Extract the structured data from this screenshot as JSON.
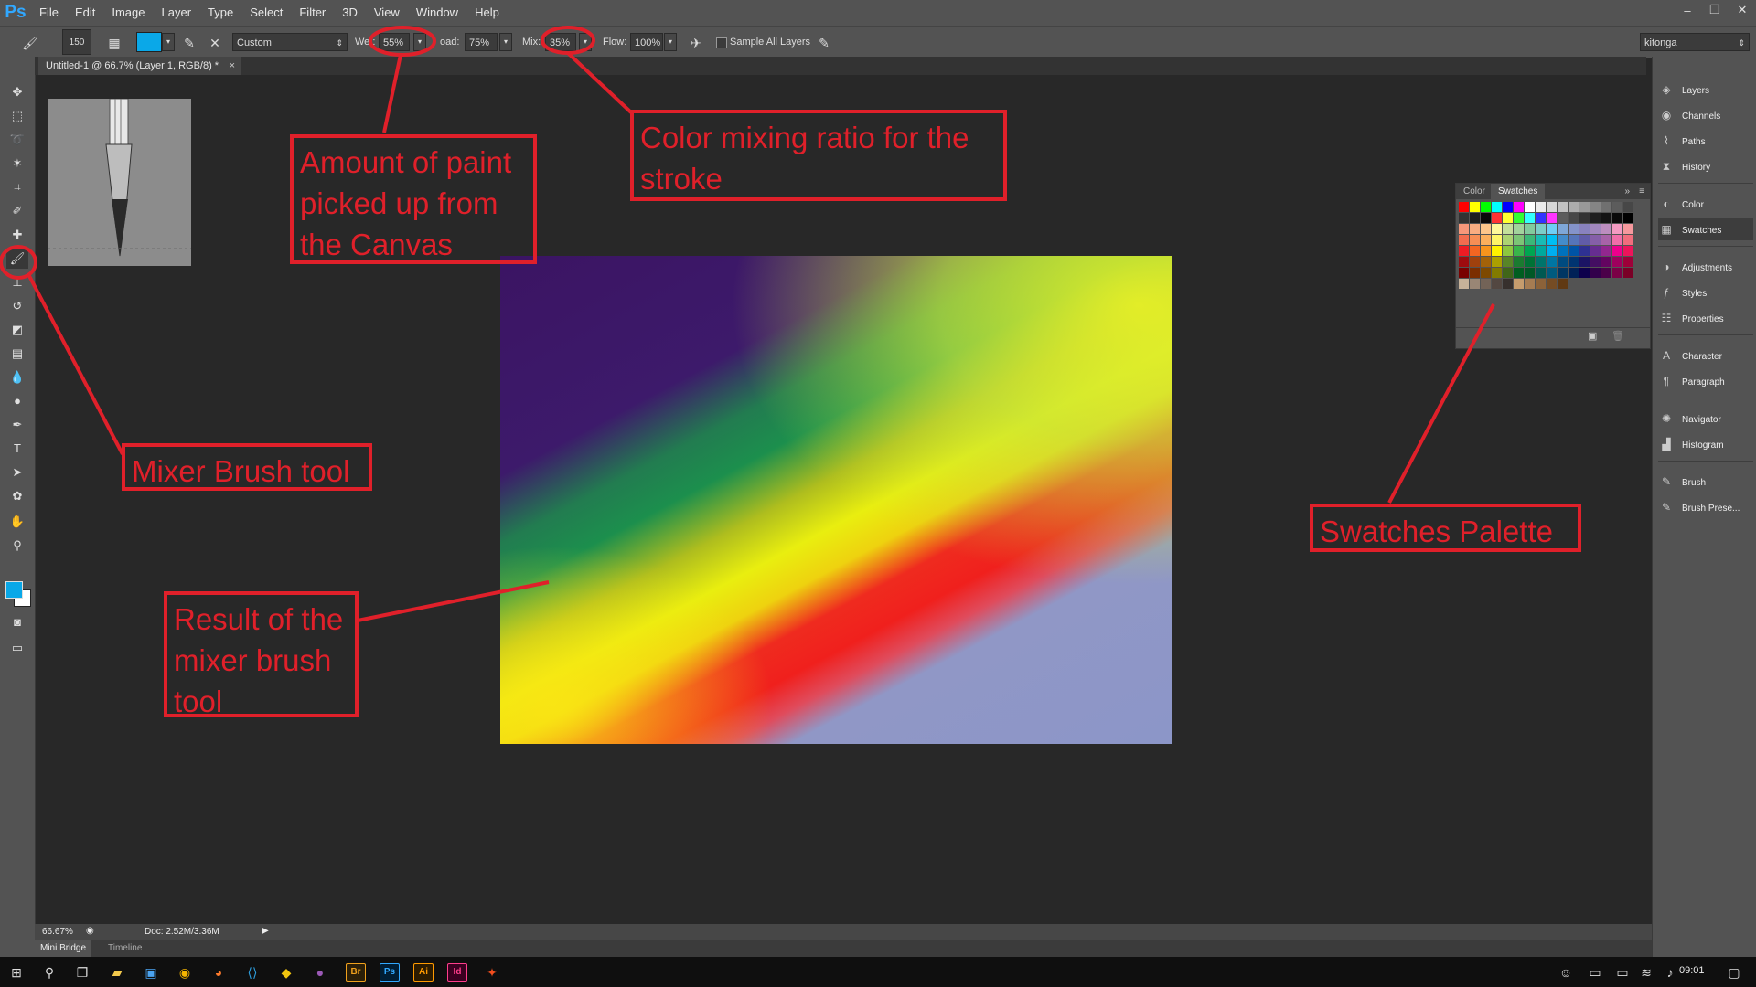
{
  "app": {
    "logo": "Ps"
  },
  "menu": [
    "File",
    "Edit",
    "Image",
    "Layer",
    "Type",
    "Select",
    "Filter",
    "3D",
    "View",
    "Window",
    "Help"
  ],
  "window_controls": {
    "minimize": "‒",
    "restore": "❐",
    "close": "✕"
  },
  "options": {
    "brush_size": "150",
    "preset": "Custom",
    "wet_label": "Wet:",
    "wet_value": "55%",
    "load_label": "oad:",
    "load_value": "75%",
    "mix_label": "Mix:",
    "mix_value": "35%",
    "flow_label": "Flow:",
    "flow_value": "100%",
    "sample_all_layers": "Sample All Layers",
    "workspace": "kitonga",
    "foreground_color": "#0aa8e8"
  },
  "document_tab": {
    "title": "Untitled-1 @ 66.7% (Layer 1, RGB/8) *",
    "close": "×"
  },
  "dock": {
    "items": [
      "Layers",
      "Channels",
      "Paths",
      "History",
      "Color",
      "Swatches",
      "Adjustments",
      "Styles",
      "Properties",
      "Character",
      "Paragraph",
      "Navigator",
      "Histogram",
      "Brush",
      "Brush Prese..."
    ],
    "active": "Swatches"
  },
  "swatches_panel": {
    "tabs": [
      "Color",
      "Swatches"
    ],
    "active_tab": "Swatches",
    "rows": [
      [
        "#ff0000",
        "#ffff00",
        "#00ff00",
        "#00ffff",
        "#0000ff",
        "#ff00ff",
        "#ffffff",
        "#ebebeb",
        "#d6d6d6",
        "#c2c2c2",
        "#adadad",
        "#999999",
        "#858585",
        "#707070",
        "#5c5c5c",
        "#474747"
      ],
      [
        "#333333",
        "#1f1f1f",
        "#0a0a0a",
        "#ff3333",
        "#ffff33",
        "#33ff33",
        "#33ffff",
        "#3333ff",
        "#ff33ff",
        "#5c5c5c",
        "#474747",
        "#333333",
        "#1f1f1f",
        "#141414",
        "#0a0a0a",
        "#000000"
      ],
      [
        "#f7977a",
        "#f9ad81",
        "#fdc68a",
        "#fff79a",
        "#c4df9b",
        "#a2d39c",
        "#82ca9d",
        "#7bcdc8",
        "#6ecff6",
        "#7ea7d8",
        "#8493ca",
        "#8882be",
        "#a187be",
        "#bc8dbf",
        "#f49ac2",
        "#f6989d"
      ],
      [
        "#f26c4f",
        "#f68e55",
        "#fbaf5c",
        "#fff467",
        "#acd372",
        "#7cc576",
        "#3bb878",
        "#1abbb4",
        "#00bff3",
        "#438ccb",
        "#5574b9",
        "#605ca8",
        "#855fa8",
        "#a763a8",
        "#f06ea9",
        "#f26d7d"
      ],
      [
        "#ed1c24",
        "#f26522",
        "#f7941d",
        "#fff200",
        "#8dc73f",
        "#39b54a",
        "#00a651",
        "#00a99d",
        "#00aeef",
        "#0072bc",
        "#0054a6",
        "#2e3192",
        "#662d91",
        "#92278f",
        "#ec008c",
        "#ed145b"
      ],
      [
        "#9e0b0f",
        "#a0410d",
        "#a36209",
        "#aba000",
        "#598527",
        "#1a7b30",
        "#007236",
        "#00746b",
        "#0076a3",
        "#004b80",
        "#003471",
        "#1b1464",
        "#440e62",
        "#630460",
        "#9e005d",
        "#9e0039"
      ],
      [
        "#790000",
        "#7b2e00",
        "#7d4900",
        "#827b00",
        "#406618",
        "#005e20",
        "#005826",
        "#005952",
        "#005b7f",
        "#003663",
        "#002157",
        "#0d004c",
        "#32004b",
        "#4b0049",
        "#7b0046",
        "#7a0026"
      ],
      [
        "#c7b299",
        "#998675",
        "#736357",
        "#534741",
        "#37302d",
        "#c69c6d",
        "#a67c52",
        "#8c6239",
        "#754c24",
        "#603913"
      ]
    ]
  },
  "status": {
    "zoom": "66.67%",
    "doc": "Doc: 2.52M/3.36M"
  },
  "bottom_tabs": [
    "Mini Bridge",
    "Timeline"
  ],
  "annotations": {
    "wet": "Amount of paint picked up from the Canvas",
    "mix": "Color mixing ratio for the stroke",
    "tool": "Mixer Brush tool",
    "result": "Result of the mixer brush tool",
    "swatches": "Swatches Palette",
    "color": "#e0202a"
  },
  "taskbar": {
    "time": "09:01"
  }
}
